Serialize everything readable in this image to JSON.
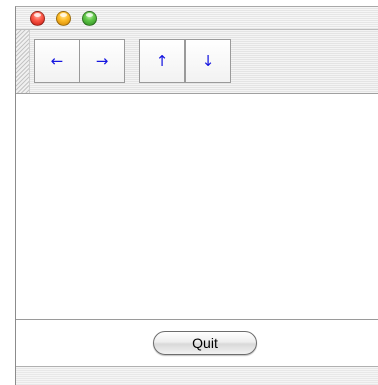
{
  "window": {
    "controls": [
      {
        "name": "close",
        "icon": "close-traffic-light-icon",
        "color": "#ff5b4a"
      },
      {
        "name": "minimize",
        "icon": "minimize-traffic-light-icon",
        "color": "#ffbe2a"
      },
      {
        "name": "zoom",
        "icon": "zoom-traffic-light-icon",
        "color": "#62c94a"
      }
    ]
  },
  "toolbar": {
    "buttons": [
      {
        "label": "←",
        "icon": "arrow-left-icon"
      },
      {
        "label": "→",
        "icon": "arrow-right-icon"
      },
      {
        "label": "↑",
        "icon": "arrow-up-icon"
      },
      {
        "label": "↓",
        "icon": "arrow-down-icon"
      }
    ],
    "arrow_color": "#1515e0"
  },
  "footer": {
    "quit_label": "Quit"
  }
}
